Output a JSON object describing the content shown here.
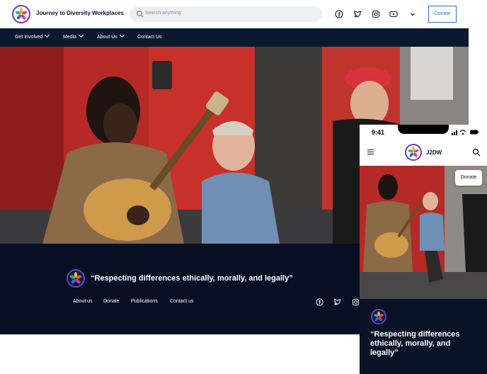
{
  "site": {
    "name": "Journey to Diversity Workplaces",
    "short_name": "J2DW"
  },
  "search": {
    "placeholder": "Search anything"
  },
  "header": {
    "social_icons": [
      "facebook-icon",
      "twitter-icon",
      "instagram-icon",
      "youtube-icon"
    ],
    "donate_label": "Donate"
  },
  "nav": {
    "items": [
      {
        "label": "Get Involved",
        "dropdown": true
      },
      {
        "label": "Media",
        "dropdown": true
      },
      {
        "label": "About Us",
        "dropdown": true
      },
      {
        "label": "Contact Us",
        "dropdown": false
      }
    ]
  },
  "footer": {
    "quote": "“Respecting differences ethically, morally, and legally”",
    "links": [
      "About us",
      "Donate",
      "Publications",
      "Contact us"
    ],
    "social_icons": [
      "facebook-icon",
      "twitter-icon",
      "instagram-icon"
    ]
  },
  "mobile": {
    "time": "9:41",
    "donate_label": "Donate",
    "quote": "“Respecting differences ethically, morally, and legally”"
  },
  "colors": {
    "nav_bg": "#0a1930",
    "footer_bg": "#080f22",
    "accent": "#2f6be0",
    "brand_purple": "#6d3cc7"
  }
}
